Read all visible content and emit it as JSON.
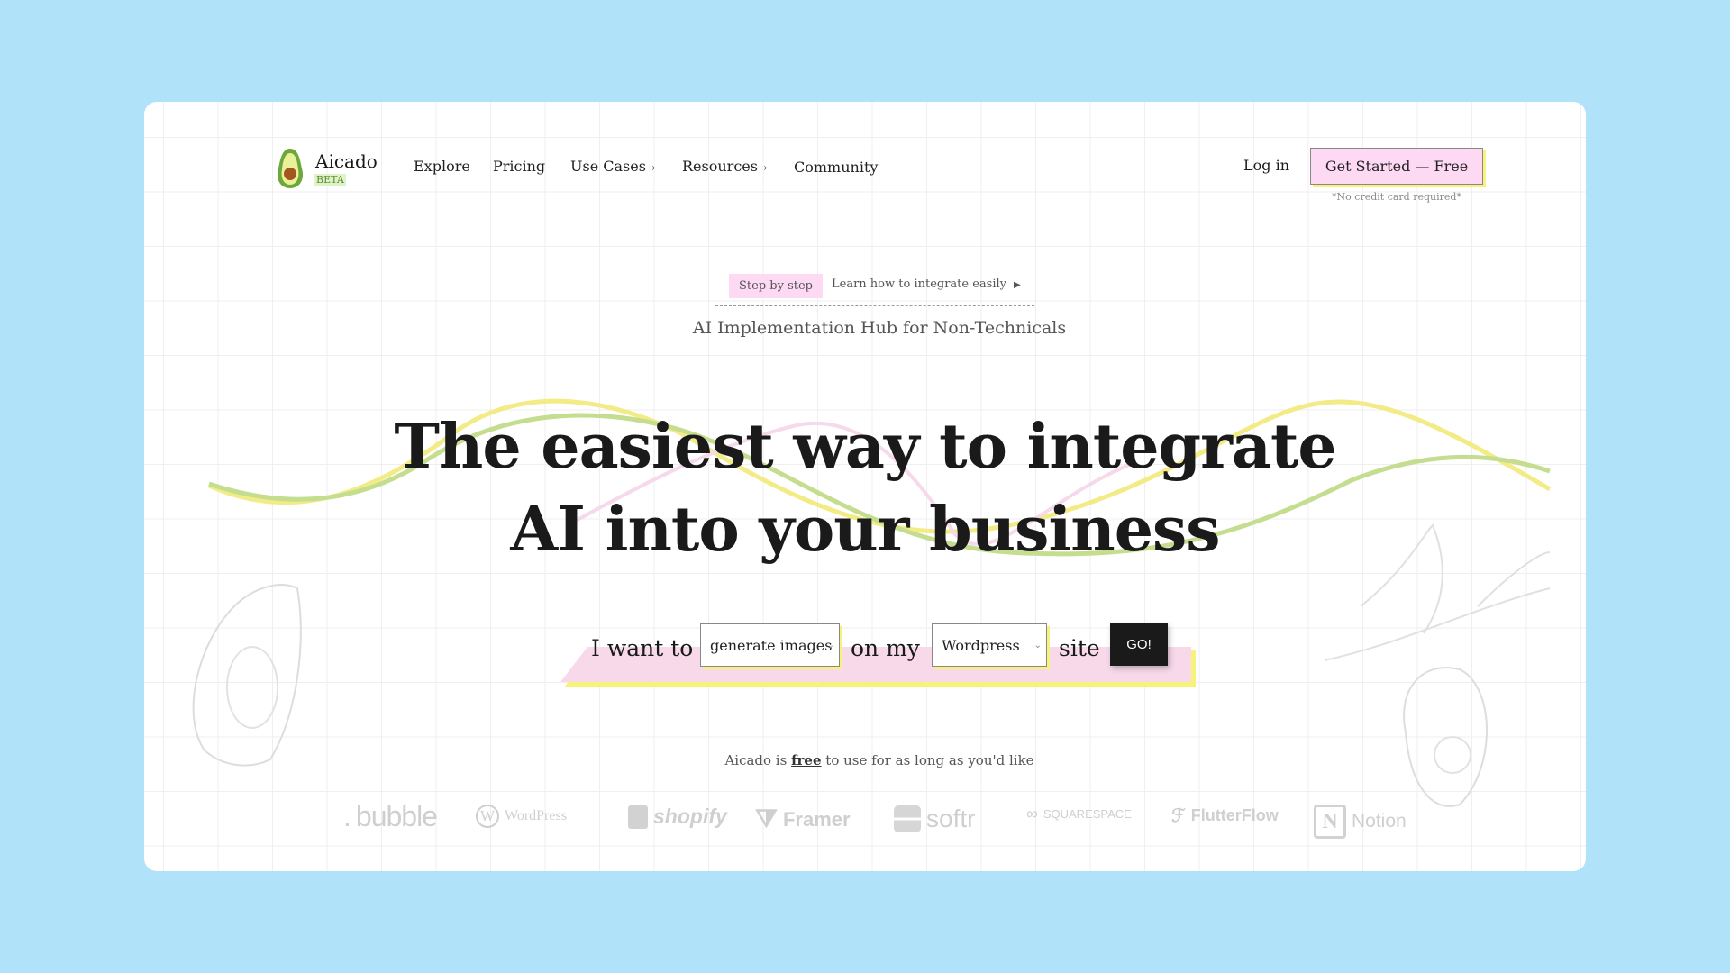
{
  "brand": {
    "name": "Aicado",
    "badge": "BETA"
  },
  "nav": {
    "items": [
      {
        "label": "Explore"
      },
      {
        "label": "Pricing"
      },
      {
        "label": "Use Cases",
        "chevron": true
      },
      {
        "label": "Resources",
        "chevron": true
      },
      {
        "label": "Community"
      }
    ],
    "login": "Log in",
    "cta": "Get Started — Free",
    "cta_note": "*No credit card required*"
  },
  "announce": {
    "pill": "Step by step",
    "link": "Learn how to integrate easily"
  },
  "hero": {
    "subtitle": "AI Implementation Hub for Non-Technicals",
    "line1": "The easiest way to integrate",
    "line2": "AI into your business"
  },
  "form": {
    "prefix": "I want to",
    "goal_value": "generate images",
    "middle": "on my",
    "platform_value": "Wordpress",
    "suffix": "site",
    "go": "GO!"
  },
  "free": {
    "before": "Aicado is ",
    "link": "free",
    "after": " to use for as long as you'd like"
  },
  "logos": [
    "bubble",
    "WordPress",
    "shopify",
    "Framer",
    "softr",
    "SQUARESPACE",
    "FlutterFlow",
    "Notion"
  ],
  "colors": {
    "background": "#b0e2f9",
    "pink": "#fdd9f4",
    "yellow": "#f7f27a",
    "green": "#c5dd8f",
    "go_button": "#1a1a1a"
  }
}
